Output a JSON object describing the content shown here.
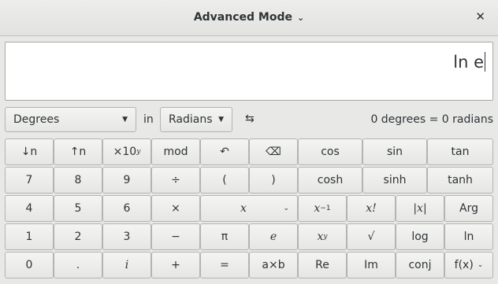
{
  "window": {
    "title": "Advanced Mode",
    "close_glyph": "✕"
  },
  "display": {
    "expression": "ln e"
  },
  "conversion": {
    "from_unit": "Degrees",
    "in_label": "in",
    "to_unit": "Radians",
    "swap_glyph": "⇆",
    "result": "0 degrees = 0 radians"
  },
  "keys": {
    "shift_down": "↓n",
    "shift_up": "↑n",
    "sci_base": "×10",
    "sci_exp": "y",
    "mod": "mod",
    "undo": "↶",
    "backspace": "⌫",
    "cos": "cos",
    "sin": "sin",
    "tan": "tan",
    "n7": "7",
    "n8": "8",
    "n9": "9",
    "divide": "÷",
    "lparen": "(",
    "rparen": ")",
    "cosh": "cosh",
    "sinh": "sinh",
    "tanh": "tanh",
    "n4": "4",
    "n5": "5",
    "n6": "6",
    "multiply": "×",
    "variable": "x",
    "inverse_base": "x",
    "inverse_exp": "−1",
    "factorial": "x!",
    "abs": "|x|",
    "arg": "Arg",
    "n1": "1",
    "n2": "2",
    "n3": "3",
    "subtract": "−",
    "pi": "π",
    "euler": "e",
    "power_base": "x",
    "power_exp": "y",
    "sqrt": "√",
    "log": "log",
    "ln": "ln",
    "n0": "0",
    "point": ".",
    "imag": "i",
    "add": "+",
    "equals": "=",
    "product": "a×b",
    "re": "Re",
    "im": "Im",
    "conj": "conj",
    "fx": "f(x)"
  }
}
